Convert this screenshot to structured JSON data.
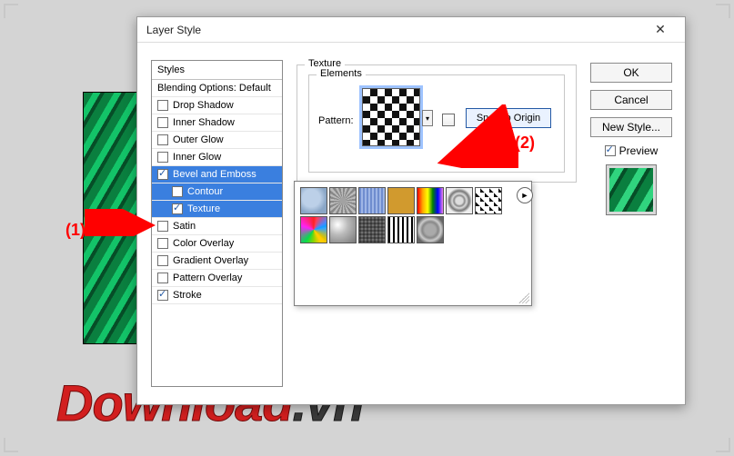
{
  "dialog": {
    "title": "Layer Style",
    "close_glyph": "✕"
  },
  "styles_panel": {
    "header": "Styles",
    "blending_default": "Blending Options: Default",
    "items": {
      "drop_shadow": "Drop Shadow",
      "inner_shadow": "Inner Shadow",
      "outer_glow": "Outer Glow",
      "inner_glow": "Inner Glow",
      "bevel_emboss": "Bevel and Emboss",
      "contour": "Contour",
      "texture": "Texture",
      "satin": "Satin",
      "color_overlay": "Color Overlay",
      "gradient_overlay": "Gradient Overlay",
      "pattern_overlay": "Pattern Overlay",
      "stroke": "Stroke"
    }
  },
  "texture_section": {
    "group_label": "Texture",
    "elements_label": "Elements",
    "pattern_label": "Pattern:",
    "dropdown_glyph": "▾",
    "snap_label": "Snap to Origin"
  },
  "flyout": {
    "menu_glyph": "►"
  },
  "right": {
    "ok": "OK",
    "cancel": "Cancel",
    "new_style": "New Style...",
    "preview": "Preview"
  },
  "annotations": {
    "one": "(1)",
    "two": "(2)"
  },
  "watermark": {
    "main": "Download",
    "suffix": ".vn"
  }
}
